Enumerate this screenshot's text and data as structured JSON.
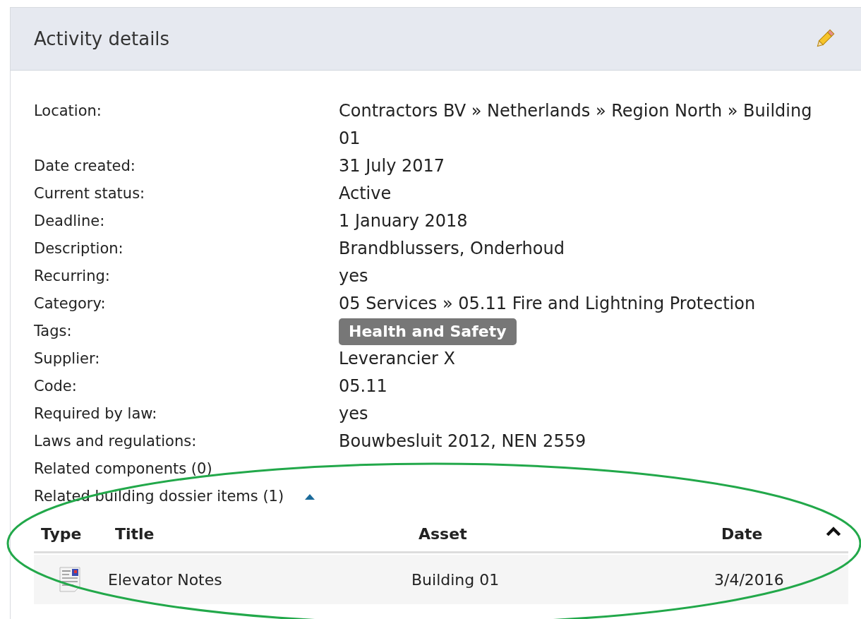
{
  "panel": {
    "title": "Activity details"
  },
  "fields": [
    {
      "kind": "text",
      "label": "Location:",
      "value": "Contractors BV » Netherlands » Region North » Building 01"
    },
    {
      "kind": "text",
      "label": "Date created:",
      "value": "31 July 2017"
    },
    {
      "kind": "text",
      "label": "Current status:",
      "value": "Active"
    },
    {
      "kind": "text",
      "label": "Deadline:",
      "value": "1 January 2018"
    },
    {
      "kind": "text",
      "label": "Description:",
      "value": "Brandblussers, Onderhoud"
    },
    {
      "kind": "text",
      "label": "Recurring:",
      "value": "yes"
    },
    {
      "kind": "text",
      "label": "Category:",
      "value": "05 Services » 05.11 Fire and Lightning Protection"
    },
    {
      "kind": "tag",
      "label": "Tags:",
      "value": "Health and Safety"
    },
    {
      "kind": "text",
      "label": "Supplier:",
      "value": "Leverancier X"
    },
    {
      "kind": "text",
      "label": "Code:",
      "value": "05.11"
    },
    {
      "kind": "text",
      "label": "Required by law:",
      "value": "yes"
    },
    {
      "kind": "text",
      "label": "Laws and regulations:",
      "value": "Bouwbesluit 2012, NEN 2559"
    }
  ],
  "related": [
    {
      "label": "Related components (0)",
      "expanded": false
    },
    {
      "label": "Related building dossier items (1)",
      "expanded": true
    }
  ],
  "table": {
    "columns": [
      "Type",
      "Title",
      "Asset",
      "Date"
    ],
    "rows": [
      {
        "title": "Elevator Notes",
        "asset": "Building 01",
        "date": "3/4/2016"
      }
    ]
  }
}
